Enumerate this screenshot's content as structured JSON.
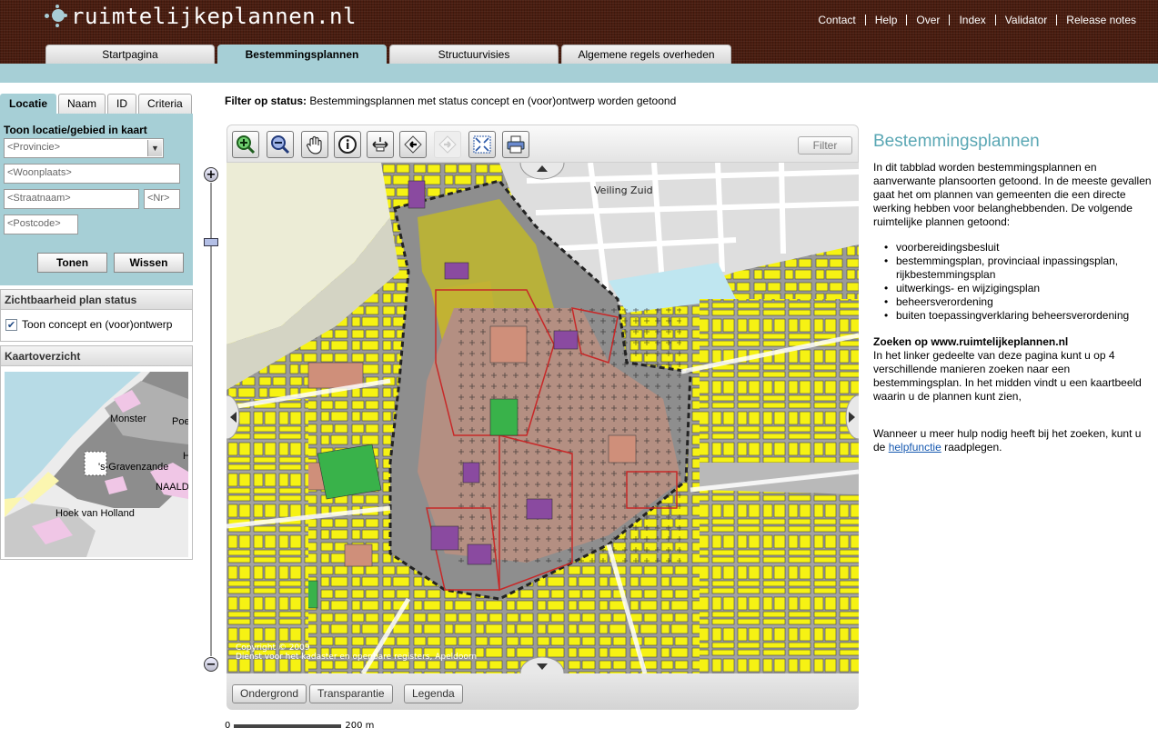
{
  "header": {
    "logo_text": "ruimtelijkeplannen.nl",
    "topnav": [
      "Contact",
      "Help",
      "Over",
      "Index",
      "Validator",
      "Release notes"
    ],
    "tabs": [
      {
        "label": "Startpagina",
        "active": false
      },
      {
        "label": "Bestemmingsplannen",
        "active": true
      },
      {
        "label": "Structuurvisies",
        "active": false
      },
      {
        "label": "Algemene regels overheden",
        "active": false
      }
    ]
  },
  "search": {
    "tabs": [
      {
        "label": "Locatie",
        "active": true
      },
      {
        "label": "Naam",
        "active": false
      },
      {
        "label": "ID",
        "active": false
      },
      {
        "label": "Criteria",
        "active": false
      }
    ],
    "heading": "Toon locatie/gebied in kaart",
    "provincie_placeholder": "<Provincie>",
    "woonplaats_placeholder": "<Woonplaats>",
    "straatnaam_placeholder": "<Straatnaam>",
    "nr_placeholder": "<Nr>",
    "postcode_placeholder": "<Postcode>",
    "tonen_label": "Tonen",
    "wissen_label": "Wissen"
  },
  "plan_status": {
    "title": "Zichtbaarheid plan status",
    "checkbox_label": "Toon concept en (voor)ontwerp",
    "checked": true
  },
  "overview": {
    "title": "Kaartoverzicht",
    "labels": [
      "Monster",
      "Poe",
      "'s-Gravenzande",
      "NAALD",
      "Hoek van Holland",
      "H"
    ]
  },
  "filter": {
    "prefix": "Filter op status:",
    "text": "Bestemmingsplannen met status concept en (voor)ontwerp worden getoond"
  },
  "map": {
    "tools": [
      "zoom-in",
      "zoom-out",
      "pan",
      "info",
      "measure",
      "previous-extent",
      "next-extent",
      "full-extent",
      "print"
    ],
    "filter_label": "Filter",
    "place_label": "Veiling Zuid",
    "copyright_line1": "Copyright © 2009",
    "copyright_line2": "Dienst voor het kadaster en openbare registers, Apeldoorn",
    "bottom_buttons": [
      "Ondergrond",
      "Transparantie",
      "Legenda"
    ],
    "scale_start": "0",
    "scale_end": "200 m"
  },
  "info": {
    "title": "Bestemmingsplannen",
    "intro": "In dit tabblad worden bestemmingsplannen en aanverwante plansoorten getoond. In de meeste gevallen gaat het om plannen van gemeenten die een directe werking hebben voor belanghebbenden. De volgende ruimtelijke plannen getoond:",
    "items": [
      "voorbereidingsbesluit",
      "bestemmingsplan, provinciaal inpassingsplan, rijkbestemmingsplan",
      "uitwerkings- en wijzigingsplan",
      "beheersverordening",
      "buiten toepassingverklaring beheersverordening"
    ],
    "search_heading": "Zoeken op www.ruimtelijkeplannen.nl",
    "search_text": "In het linker gedeelte van deze pagina kunt u op 4 verschillende manieren zoeken naar een bestemmingsplan. In het midden vindt u een kaartbeeld waarin u de plannen kunt zien,",
    "help_prefix": "Wanneer u meer hulp nodig heeft bij het zoeken, kunt u de",
    "help_link": "helpfunctie",
    "help_suffix": "raadplegen."
  },
  "colors": {
    "header_bg": "#4a1d10",
    "accent": "#a6cfd6",
    "title": "#5aa7b4",
    "link": "#1558b0",
    "map_yellow": "#f6f213",
    "map_purple": "#8a4aa0",
    "map_salmon": "#cf8f7a",
    "map_green": "#39b24a"
  }
}
